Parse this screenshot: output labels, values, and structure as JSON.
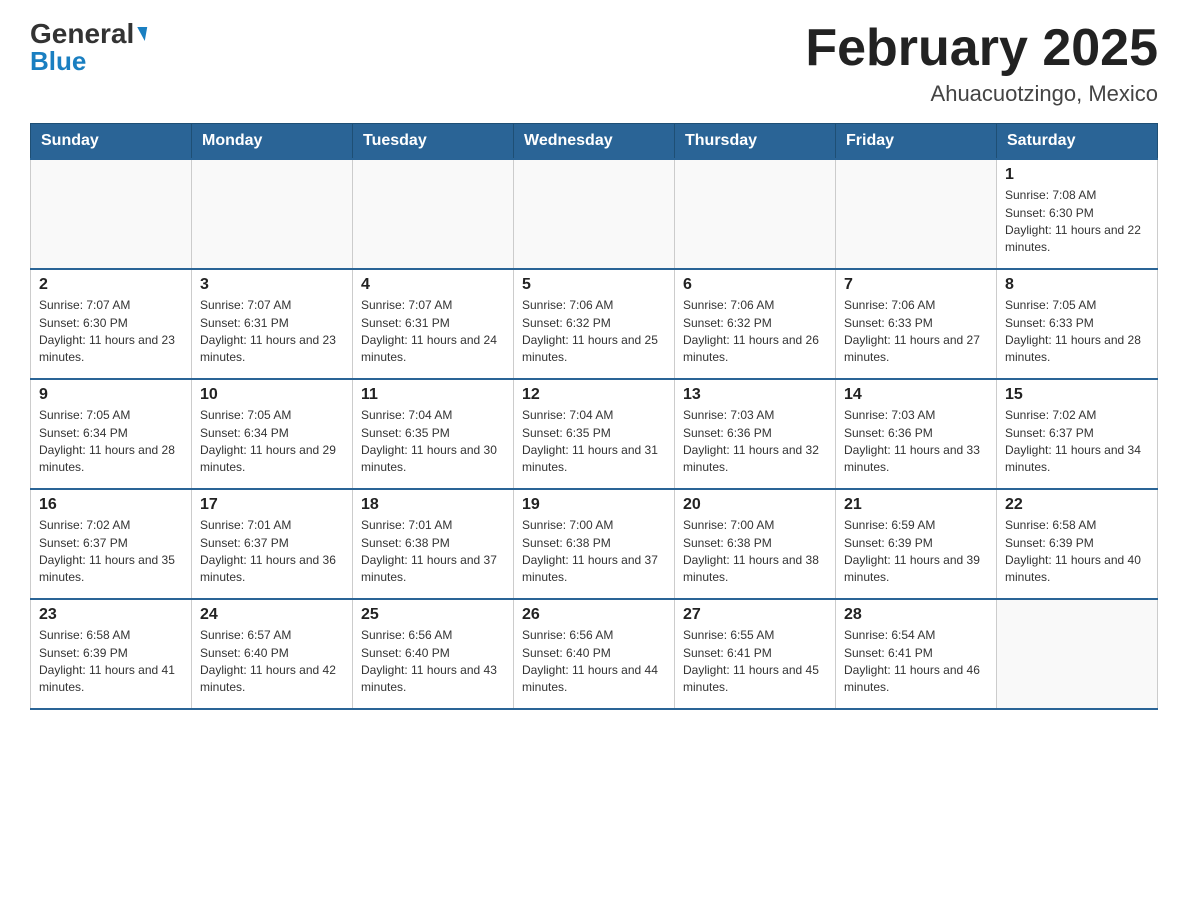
{
  "header": {
    "logo_general": "General",
    "logo_blue": "Blue",
    "month_title": "February 2025",
    "location": "Ahuacuotzingo, Mexico"
  },
  "weekdays": [
    "Sunday",
    "Monday",
    "Tuesday",
    "Wednesday",
    "Thursday",
    "Friday",
    "Saturday"
  ],
  "weeks": [
    [
      {
        "day": "",
        "sunrise": "",
        "sunset": "",
        "daylight": ""
      },
      {
        "day": "",
        "sunrise": "",
        "sunset": "",
        "daylight": ""
      },
      {
        "day": "",
        "sunrise": "",
        "sunset": "",
        "daylight": ""
      },
      {
        "day": "",
        "sunrise": "",
        "sunset": "",
        "daylight": ""
      },
      {
        "day": "",
        "sunrise": "",
        "sunset": "",
        "daylight": ""
      },
      {
        "day": "",
        "sunrise": "",
        "sunset": "",
        "daylight": ""
      },
      {
        "day": "1",
        "sunrise": "Sunrise: 7:08 AM",
        "sunset": "Sunset: 6:30 PM",
        "daylight": "Daylight: 11 hours and 22 minutes."
      }
    ],
    [
      {
        "day": "2",
        "sunrise": "Sunrise: 7:07 AM",
        "sunset": "Sunset: 6:30 PM",
        "daylight": "Daylight: 11 hours and 23 minutes."
      },
      {
        "day": "3",
        "sunrise": "Sunrise: 7:07 AM",
        "sunset": "Sunset: 6:31 PM",
        "daylight": "Daylight: 11 hours and 23 minutes."
      },
      {
        "day": "4",
        "sunrise": "Sunrise: 7:07 AM",
        "sunset": "Sunset: 6:31 PM",
        "daylight": "Daylight: 11 hours and 24 minutes."
      },
      {
        "day": "5",
        "sunrise": "Sunrise: 7:06 AM",
        "sunset": "Sunset: 6:32 PM",
        "daylight": "Daylight: 11 hours and 25 minutes."
      },
      {
        "day": "6",
        "sunrise": "Sunrise: 7:06 AM",
        "sunset": "Sunset: 6:32 PM",
        "daylight": "Daylight: 11 hours and 26 minutes."
      },
      {
        "day": "7",
        "sunrise": "Sunrise: 7:06 AM",
        "sunset": "Sunset: 6:33 PM",
        "daylight": "Daylight: 11 hours and 27 minutes."
      },
      {
        "day": "8",
        "sunrise": "Sunrise: 7:05 AM",
        "sunset": "Sunset: 6:33 PM",
        "daylight": "Daylight: 11 hours and 28 minutes."
      }
    ],
    [
      {
        "day": "9",
        "sunrise": "Sunrise: 7:05 AM",
        "sunset": "Sunset: 6:34 PM",
        "daylight": "Daylight: 11 hours and 28 minutes."
      },
      {
        "day": "10",
        "sunrise": "Sunrise: 7:05 AM",
        "sunset": "Sunset: 6:34 PM",
        "daylight": "Daylight: 11 hours and 29 minutes."
      },
      {
        "day": "11",
        "sunrise": "Sunrise: 7:04 AM",
        "sunset": "Sunset: 6:35 PM",
        "daylight": "Daylight: 11 hours and 30 minutes."
      },
      {
        "day": "12",
        "sunrise": "Sunrise: 7:04 AM",
        "sunset": "Sunset: 6:35 PM",
        "daylight": "Daylight: 11 hours and 31 minutes."
      },
      {
        "day": "13",
        "sunrise": "Sunrise: 7:03 AM",
        "sunset": "Sunset: 6:36 PM",
        "daylight": "Daylight: 11 hours and 32 minutes."
      },
      {
        "day": "14",
        "sunrise": "Sunrise: 7:03 AM",
        "sunset": "Sunset: 6:36 PM",
        "daylight": "Daylight: 11 hours and 33 minutes."
      },
      {
        "day": "15",
        "sunrise": "Sunrise: 7:02 AM",
        "sunset": "Sunset: 6:37 PM",
        "daylight": "Daylight: 11 hours and 34 minutes."
      }
    ],
    [
      {
        "day": "16",
        "sunrise": "Sunrise: 7:02 AM",
        "sunset": "Sunset: 6:37 PM",
        "daylight": "Daylight: 11 hours and 35 minutes."
      },
      {
        "day": "17",
        "sunrise": "Sunrise: 7:01 AM",
        "sunset": "Sunset: 6:37 PM",
        "daylight": "Daylight: 11 hours and 36 minutes."
      },
      {
        "day": "18",
        "sunrise": "Sunrise: 7:01 AM",
        "sunset": "Sunset: 6:38 PM",
        "daylight": "Daylight: 11 hours and 37 minutes."
      },
      {
        "day": "19",
        "sunrise": "Sunrise: 7:00 AM",
        "sunset": "Sunset: 6:38 PM",
        "daylight": "Daylight: 11 hours and 37 minutes."
      },
      {
        "day": "20",
        "sunrise": "Sunrise: 7:00 AM",
        "sunset": "Sunset: 6:38 PM",
        "daylight": "Daylight: 11 hours and 38 minutes."
      },
      {
        "day": "21",
        "sunrise": "Sunrise: 6:59 AM",
        "sunset": "Sunset: 6:39 PM",
        "daylight": "Daylight: 11 hours and 39 minutes."
      },
      {
        "day": "22",
        "sunrise": "Sunrise: 6:58 AM",
        "sunset": "Sunset: 6:39 PM",
        "daylight": "Daylight: 11 hours and 40 minutes."
      }
    ],
    [
      {
        "day": "23",
        "sunrise": "Sunrise: 6:58 AM",
        "sunset": "Sunset: 6:39 PM",
        "daylight": "Daylight: 11 hours and 41 minutes."
      },
      {
        "day": "24",
        "sunrise": "Sunrise: 6:57 AM",
        "sunset": "Sunset: 6:40 PM",
        "daylight": "Daylight: 11 hours and 42 minutes."
      },
      {
        "day": "25",
        "sunrise": "Sunrise: 6:56 AM",
        "sunset": "Sunset: 6:40 PM",
        "daylight": "Daylight: 11 hours and 43 minutes."
      },
      {
        "day": "26",
        "sunrise": "Sunrise: 6:56 AM",
        "sunset": "Sunset: 6:40 PM",
        "daylight": "Daylight: 11 hours and 44 minutes."
      },
      {
        "day": "27",
        "sunrise": "Sunrise: 6:55 AM",
        "sunset": "Sunset: 6:41 PM",
        "daylight": "Daylight: 11 hours and 45 minutes."
      },
      {
        "day": "28",
        "sunrise": "Sunrise: 6:54 AM",
        "sunset": "Sunset: 6:41 PM",
        "daylight": "Daylight: 11 hours and 46 minutes."
      },
      {
        "day": "",
        "sunrise": "",
        "sunset": "",
        "daylight": ""
      }
    ]
  ]
}
